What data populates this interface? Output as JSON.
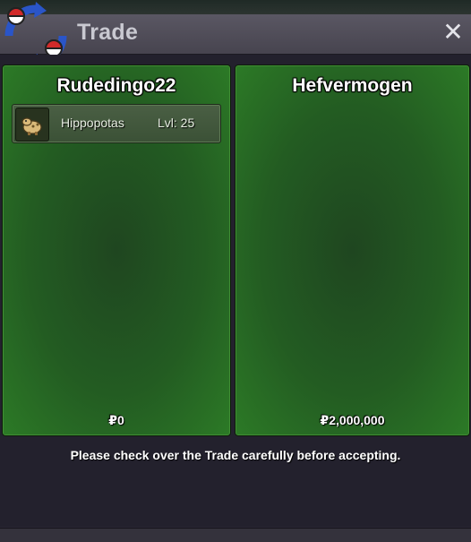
{
  "window": {
    "title": "Trade",
    "close_label": "✕"
  },
  "trade": {
    "left": {
      "player_name": "Rudedingo22",
      "items": [
        {
          "name": "Hippopotas",
          "level": "Lvl: 25",
          "icon": "hippopotas-sprite-icon"
        }
      ],
      "money": "₽0"
    },
    "right": {
      "player_name": "Hefvermogen",
      "items": [],
      "money": "₽2,000,000"
    }
  },
  "notice": "Please check over the Trade carefully before accepting.",
  "colors": {
    "panel_green": "#2c7a26",
    "background": "#262330",
    "titlebar": "#4f4c58"
  }
}
